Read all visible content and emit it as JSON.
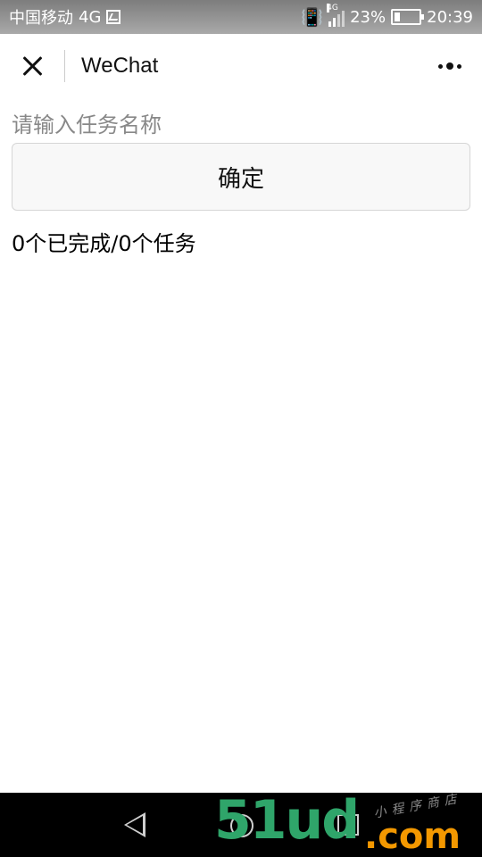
{
  "status_bar": {
    "carrier": "中国移动",
    "network": "4G",
    "gallery_icon": "image-notification-icon",
    "vibrate_icon": "vibrate-icon",
    "signal_label": "4G",
    "battery": "23%",
    "battery_level": 0.23,
    "time": "20:39"
  },
  "nav": {
    "close_icon": "close-icon",
    "title": "WeChat",
    "more_icon": "more-icon"
  },
  "task_form": {
    "input_value": "",
    "input_placeholder": "请输入任务名称",
    "confirm_label": "确定"
  },
  "summary": {
    "text": "0个已完成/0个任务"
  },
  "system_nav": {
    "back_icon": "back-triangle-icon",
    "home_icon": "home-circle-icon",
    "recent_icon": "recent-square-icon"
  },
  "watermark": {
    "brand": "51ud",
    "domain": ".com",
    "tagline": "小程序商店",
    "brand_color": "#2fa56a",
    "domain_color": "#f39800"
  },
  "colors": {
    "status_bar_bg": "#8c8c8c",
    "button_bg": "#f8f8f8",
    "text_primary": "#000000",
    "placeholder": "#888888"
  }
}
